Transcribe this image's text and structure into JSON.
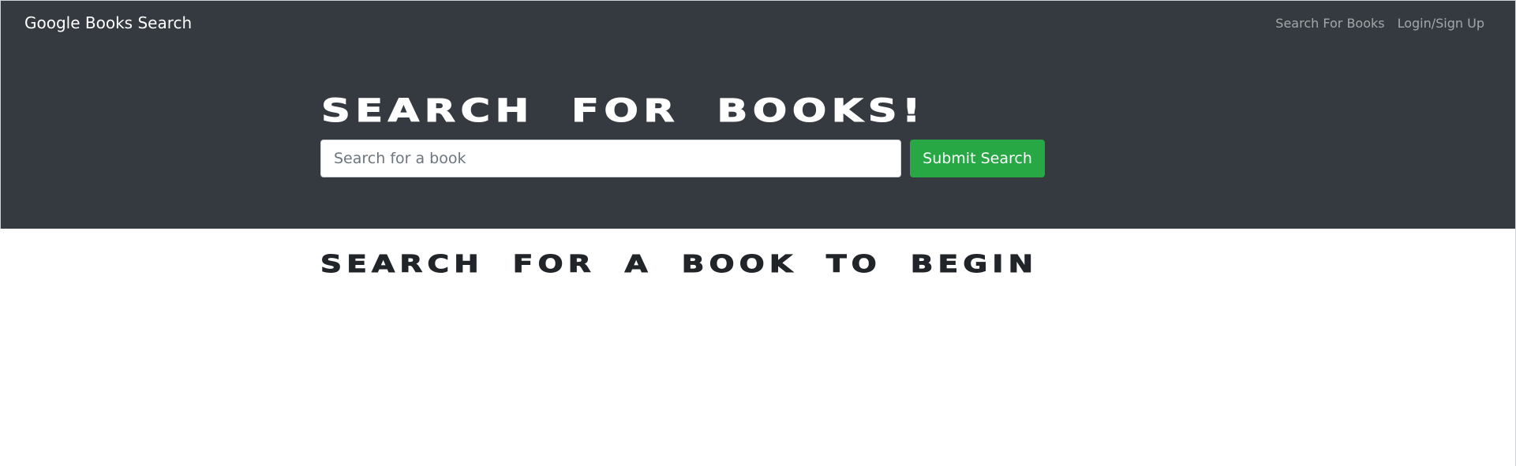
{
  "navbar": {
    "brand": "Google Books Search",
    "links": [
      {
        "label": "Search For Books"
      },
      {
        "label": "Login/Sign Up"
      }
    ]
  },
  "hero": {
    "title": "Search for Books!",
    "search": {
      "placeholder": "Search for a book",
      "value": ""
    },
    "submit_label": "Submit Search"
  },
  "results": {
    "heading": "Search for a book to begin"
  },
  "colors": {
    "header_bg": "#343a40",
    "submit_bg": "#28a745",
    "text_dark": "#212529"
  }
}
